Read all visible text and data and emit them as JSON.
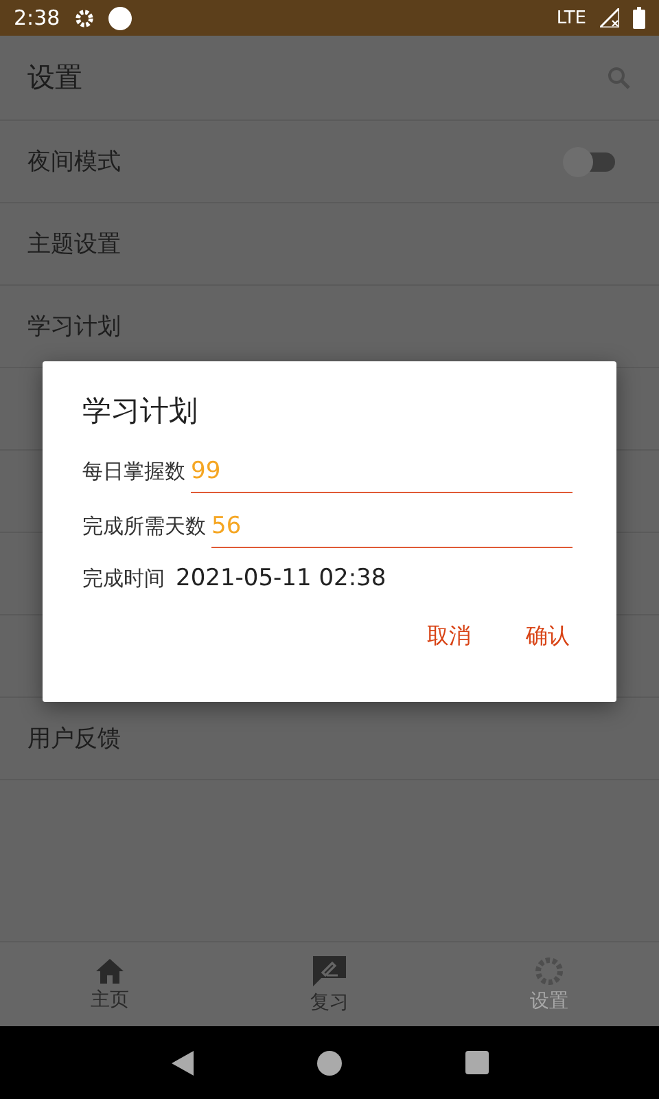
{
  "status_bar": {
    "time": "2:38",
    "network": "LTE"
  },
  "app_bar": {
    "title": "设置"
  },
  "settings": [
    {
      "kind": "switch",
      "label": "夜间模式",
      "on": false
    },
    {
      "kind": "plain",
      "label": "主题设置"
    },
    {
      "kind": "plain",
      "label": "学习计划"
    },
    {
      "kind": "covered"
    },
    {
      "kind": "covered"
    },
    {
      "kind": "covered"
    },
    {
      "kind": "covered"
    },
    {
      "kind": "plain",
      "label": "用户反馈"
    }
  ],
  "dialog": {
    "title": "学习计划",
    "fields": [
      {
        "label": "每日掌握数",
        "value": "99"
      },
      {
        "label": "完成所需天数",
        "value": "56"
      }
    ],
    "finish_label": "完成时间",
    "finish_time": "2021-05-11 02:38",
    "buttons": [
      "取消",
      "确认"
    ]
  },
  "bottom_nav": [
    {
      "kind": "home",
      "label": "主页",
      "selected": false
    },
    {
      "kind": "review",
      "label": "复习",
      "selected": false
    },
    {
      "kind": "settings",
      "label": "设置",
      "selected": true
    }
  ]
}
